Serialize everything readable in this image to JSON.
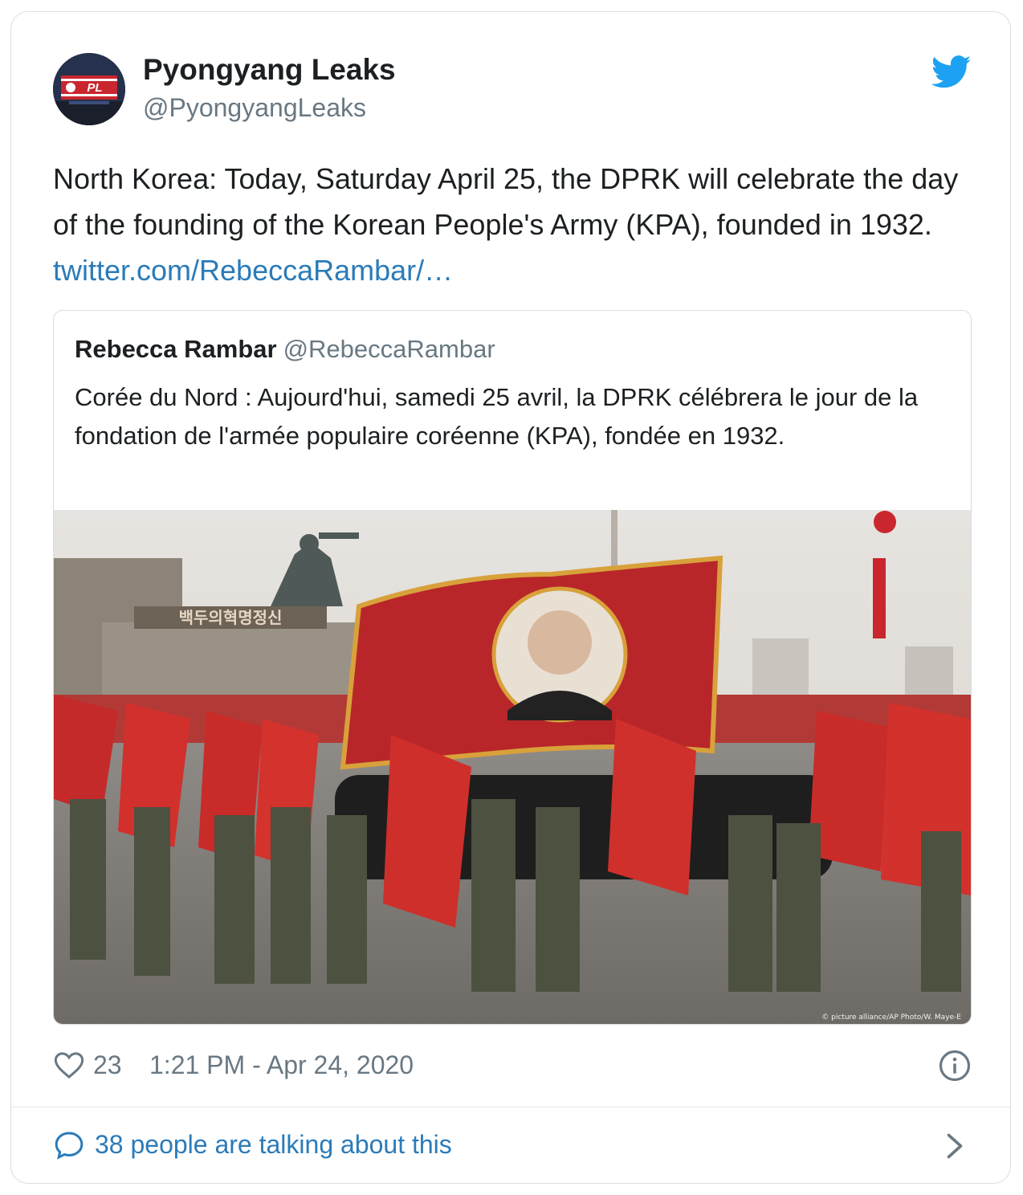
{
  "author": {
    "display_name": "Pyongyang Leaks",
    "handle": "@PyongyangLeaks",
    "avatar_label": "PL"
  },
  "tweet": {
    "text": "North Korea: Today, Saturday April 25, the DPRK will celebrate the day of the founding of the Korean People's Army (KPA), founded in 1932. ",
    "link_text": "twitter.com/RebeccaRambar/…"
  },
  "quoted": {
    "display_name": "Rebecca Rambar",
    "handle": "@RebeccaRambar",
    "text": "Corée du Nord : Aujourd'hui, samedi 25 avril, la DPRK célébrera le jour de la fondation de l'armée populaire coréenne (KPA), fondée en 1932.",
    "image_banner_text": "백두의혁명정신",
    "image_credit": "© picture alliance/AP Photo/W. Maye-E"
  },
  "footer": {
    "likes": "23",
    "timestamp": "1:21 PM - Apr 24, 2020"
  },
  "talking": {
    "text": "38 people are talking about this"
  },
  "icons": {
    "bird": "twitter-bird-icon",
    "heart": "heart-icon",
    "info": "info-icon",
    "bubble": "speech-bubble-icon",
    "chevron": "chevron-right-icon"
  },
  "colors": {
    "link": "#2b7bb9",
    "muted": "#697882",
    "text": "#1c2022",
    "border": "#d8dee2",
    "twitter_blue": "#1da1f2"
  }
}
